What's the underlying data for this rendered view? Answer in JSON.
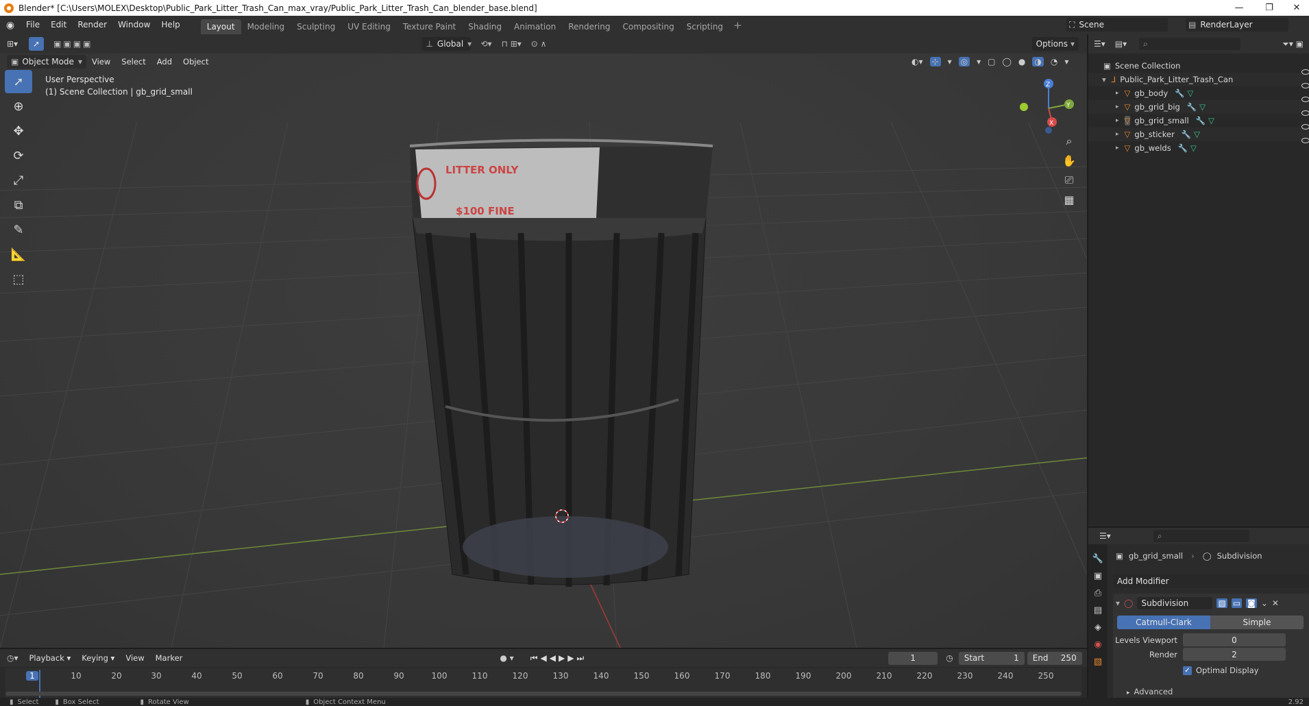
{
  "window": {
    "title": "Blender* [C:\\Users\\MOLEX\\Desktop\\Public_Park_Litter_Trash_Can_max_vray/Public_Park_Litter_Trash_Can_blender_base.blend]"
  },
  "menus": [
    "File",
    "Edit",
    "Render",
    "Window",
    "Help"
  ],
  "workspaces": [
    {
      "label": "Layout",
      "active": true
    },
    {
      "label": "Modeling"
    },
    {
      "label": "Sculpting"
    },
    {
      "label": "UV Editing"
    },
    {
      "label": "Texture Paint"
    },
    {
      "label": "Shading"
    },
    {
      "label": "Animation"
    },
    {
      "label": "Rendering"
    },
    {
      "label": "Compositing"
    },
    {
      "label": "Scripting"
    }
  ],
  "scene": {
    "name": "Scene",
    "render_layer": "RenderLayer"
  },
  "toolbar": {
    "transform": "Global",
    "options": "Options"
  },
  "viewport_header": {
    "mode": "Object Mode",
    "menus": [
      "View",
      "Select",
      "Add",
      "Object"
    ]
  },
  "viewport": {
    "perspective": "User Perspective",
    "collection_info": "(1) Scene Collection | gb_grid_small",
    "decal_text": "LITTER ONLY",
    "decal_text2": "$100 FINE"
  },
  "gizmo": {
    "x": "X",
    "y": "Y",
    "z": "Z"
  },
  "outliner": {
    "root": "Scene Collection",
    "collection": "Public_Park_Litter_Trash_Can",
    "objects": [
      "gb_body",
      "gb_grid_big",
      "gb_grid_small",
      "gb_sticker",
      "gb_welds"
    ]
  },
  "properties": {
    "object_name": "gb_grid_small",
    "modifier_tab": "Subdivision",
    "add_modifier": "Add Modifier",
    "modifier_name": "Subdivision",
    "method_catmull": "Catmull-Clark",
    "method_simple": "Simple",
    "levels_viewport_label": "Levels Viewport",
    "levels_viewport_value": "0",
    "render_label": "Render",
    "render_value": "2",
    "optimal_display": "Optimal Display",
    "advanced": "Advanced"
  },
  "timeline": {
    "menus": [
      "Playback",
      "Keying",
      "View",
      "Marker"
    ],
    "current_frame": "1",
    "start_label": "Start",
    "start_value": "1",
    "end_label": "End",
    "end_value": "250",
    "ticks": [
      "1",
      "10",
      "20",
      "30",
      "40",
      "50",
      "60",
      "70",
      "80",
      "90",
      "100",
      "110",
      "120",
      "130",
      "140",
      "150",
      "160",
      "170",
      "180",
      "190",
      "200",
      "210",
      "220",
      "230",
      "240",
      "250"
    ]
  },
  "statusbar": {
    "select": "Select",
    "box_select": "Box Select",
    "rotate_view": "Rotate View",
    "context_menu": "Object Context Menu",
    "version": "2.92"
  }
}
